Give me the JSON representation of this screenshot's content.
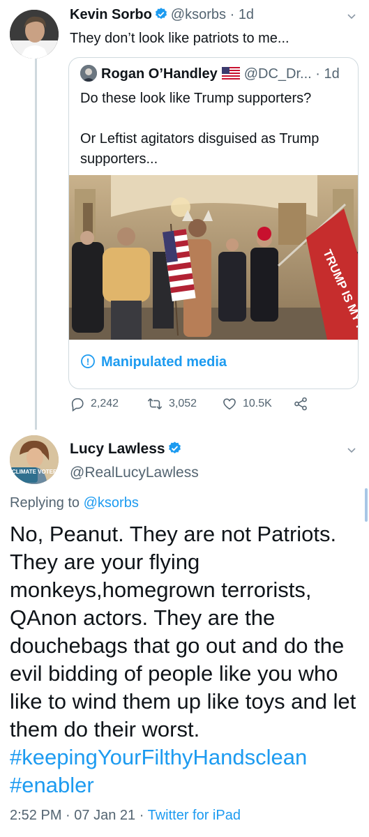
{
  "tweet1": {
    "author_name": "Kevin Sorbo",
    "author_handle": "@ksorbs",
    "separator": "·",
    "time": "1d",
    "text": "They don’t look like patriots to me...",
    "quote": {
      "author_name": "Rogan O’Handley",
      "author_handle": "@DC_Dr...",
      "separator": "·",
      "time": "1d",
      "text_line1": "Do these look like Trump supporters?",
      "text_line2": "Or Leftist agitators disguised as Trump supporters...",
      "flag_text": "TRUMP IS MY PRESIDENT",
      "label": "Manipulated media"
    },
    "actions": {
      "replies": "2,242",
      "retweets": "3,052",
      "likes": "10.5K"
    }
  },
  "tweet2": {
    "author_name": "Lucy Lawless",
    "author_handle": "@RealLucyLawless",
    "avatar_badge": "CLIMATE VOTER",
    "replying_prefix": "Replying to",
    "replying_to": "@ksorbs",
    "text": "No, Peanut. They are not Patriots. They are your flying monkeys,homegrown terrorists, QAnon actors. They are the douchebags that go out and do the evil bidding of people like you who like to wind them up like toys and let them do their worst.",
    "hashtag1": "#keepingYourFilthyHandsclean",
    "hashtag2": "#enabler",
    "time": "2:52 PM",
    "date": "07 Jan 21",
    "sep": "·",
    "source": "Twitter for iPad"
  },
  "colors": {
    "accent": "#1d9bf0",
    "secondary_text": "#536471",
    "border": "#cfd9de"
  },
  "icons": [
    "verified-badge-icon",
    "chevron-down-icon",
    "info-circle-icon",
    "reply-icon",
    "retweet-icon",
    "like-icon",
    "share-icon",
    "us-flag-icon"
  ]
}
